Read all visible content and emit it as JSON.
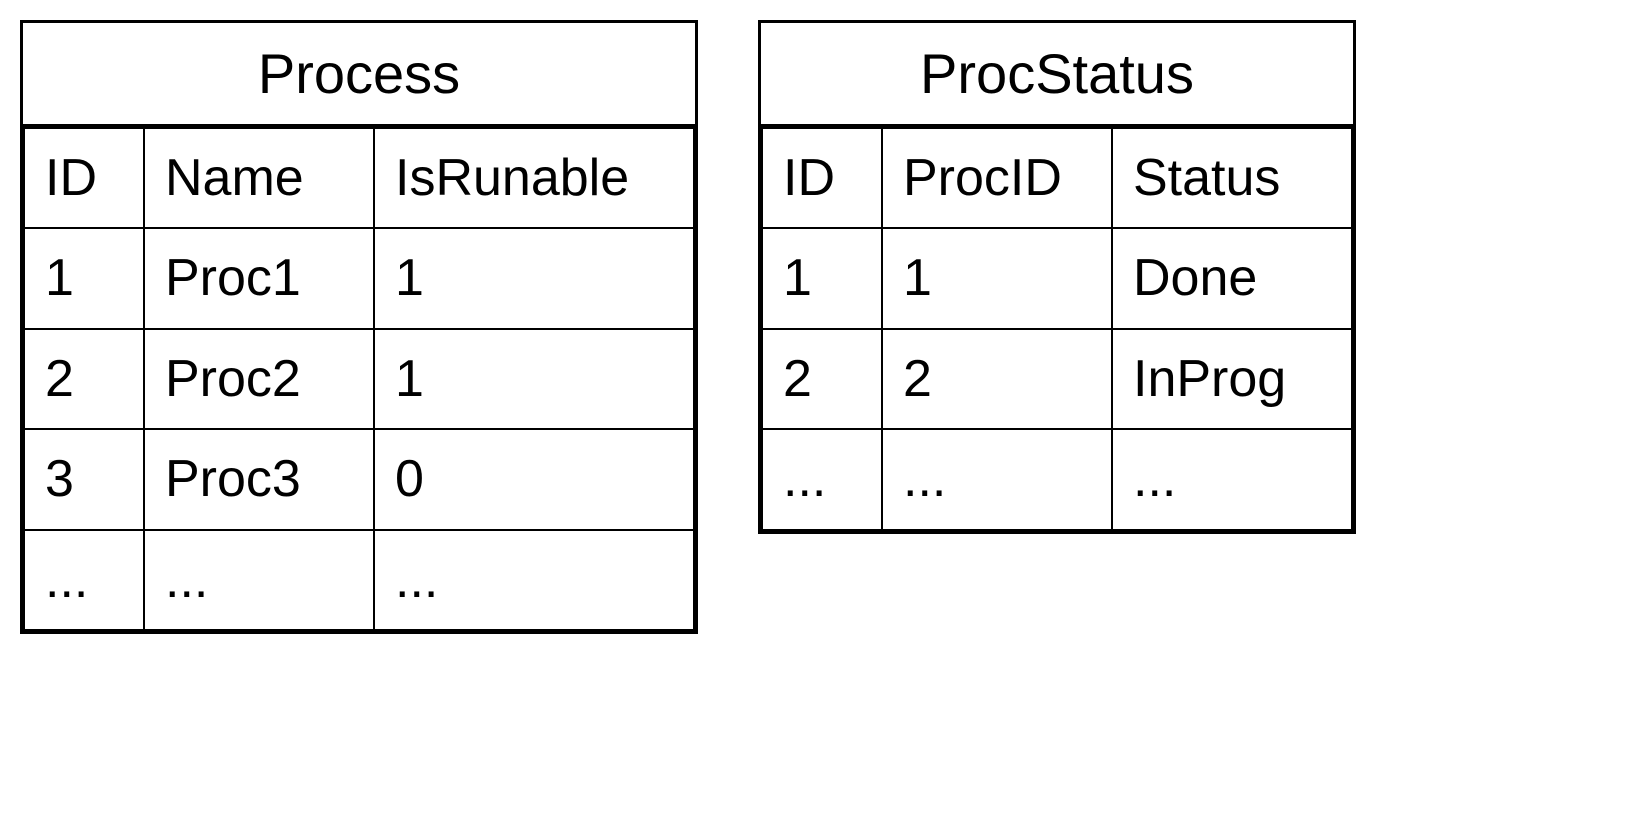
{
  "tables": [
    {
      "title": "Process",
      "columns": [
        "ID",
        "Name",
        "IsRunable"
      ],
      "rows": [
        [
          "1",
          "Proc1",
          "1"
        ],
        [
          "2",
          "Proc2",
          "1"
        ],
        [
          "3",
          "Proc3",
          "0"
        ],
        [
          "...",
          "...",
          "..."
        ]
      ]
    },
    {
      "title": "ProcStatus",
      "columns": [
        "ID",
        "ProcID",
        "Status"
      ],
      "rows": [
        [
          "1",
          "1",
          "Done"
        ],
        [
          "2",
          "2",
          "InProg"
        ],
        [
          "...",
          "...",
          "..."
        ]
      ]
    }
  ]
}
